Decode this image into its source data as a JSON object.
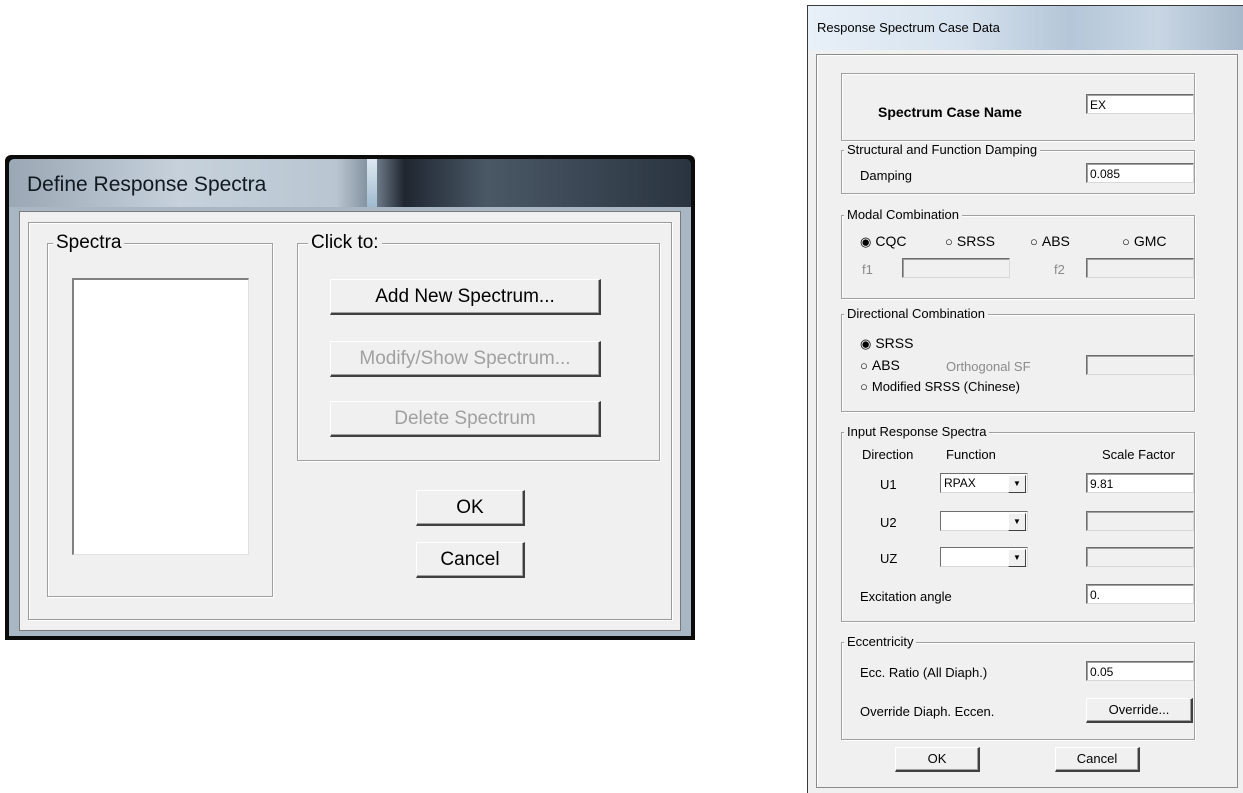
{
  "define_dialog": {
    "title": "Define Response Spectra",
    "spectra_group_label": "Spectra",
    "click_group_label": "Click to:",
    "add_button": "Add New Spectrum...",
    "modify_button": "Modify/Show Spectrum...",
    "delete_button": "Delete Spectrum",
    "ok_button": "OK",
    "cancel_button": "Cancel"
  },
  "case_dialog": {
    "title": "Response Spectrum Case Data",
    "case_name_label": "Spectrum Case Name",
    "case_name_value": "EX",
    "damping_group": "Structural and Function Damping",
    "damping_label": "Damping",
    "damping_value": "0.085",
    "modal_group": "Modal Combination",
    "modal_options": [
      "CQC",
      "SRSS",
      "ABS",
      "GMC"
    ],
    "modal_selected": "CQC",
    "f1_label": "f1",
    "f2_label": "f2",
    "directional_group": "Directional Combination",
    "directional_options": [
      "SRSS",
      "ABS",
      "Modified SRSS (Chinese)"
    ],
    "directional_selected": "SRSS",
    "orthogonal_label": "Orthogonal SF",
    "input_group": "Input Response Spectra",
    "col_direction": "Direction",
    "col_function": "Function",
    "col_scale": "Scale Factor",
    "rows": [
      {
        "direction": "U1",
        "function": "RPAX",
        "scale": "9.81"
      },
      {
        "direction": "U2",
        "function": "",
        "scale": ""
      },
      {
        "direction": "UZ",
        "function": "",
        "scale": ""
      }
    ],
    "excitation_label": "Excitation  angle",
    "excitation_value": "0.",
    "ecc_group": "Eccentricity",
    "ecc_ratio_label": "Ecc. Ratio (All Diaph.)",
    "ecc_ratio_value": "0.05",
    "override_label": "Override Diaph. Eccen.",
    "override_button": "Override...",
    "ok_button": "OK",
    "cancel_button": "Cancel"
  }
}
